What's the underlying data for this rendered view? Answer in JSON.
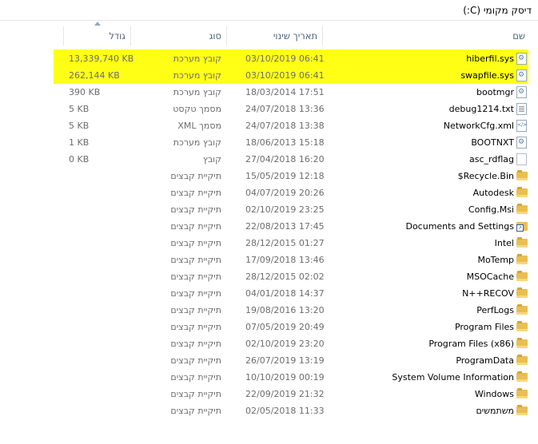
{
  "window": {
    "title": "דיסק מקומי (C:)"
  },
  "columns": {
    "name": "שם",
    "date": "תאריך שינוי",
    "type": "סוג",
    "size": "גודל"
  },
  "files": [
    {
      "name": "hiberfil.sys",
      "date": "03/10/2019 06:41",
      "type": "קובץ מערכת",
      "size": "13,339,740 KB",
      "icon": "system-file-icon",
      "highlighted": true
    },
    {
      "name": "swapfile.sys",
      "date": "03/10/2019 06:41",
      "type": "קובץ מערכת",
      "size": "262,144 KB",
      "icon": "system-file-icon",
      "highlighted": true
    },
    {
      "name": "bootmgr",
      "date": "18/03/2014 17:51",
      "type": "קובץ מערכת",
      "size": "390 KB",
      "icon": "system-file-icon",
      "highlighted": false
    },
    {
      "name": "debug1214.txt",
      "date": "24/07/2018 13:36",
      "type": "מסמך טקסט",
      "size": "5 KB",
      "icon": "text-file-icon",
      "highlighted": false
    },
    {
      "name": "NetworkCfg.xml",
      "date": "24/07/2018 13:38",
      "type": "מסמך XML",
      "size": "5 KB",
      "icon": "xml-file-icon",
      "highlighted": false
    },
    {
      "name": "BOOTNXT",
      "date": "18/06/2013 15:18",
      "type": "קובץ מערכת",
      "size": "1 KB",
      "icon": "system-file-icon",
      "highlighted": false
    },
    {
      "name": "asc_rdflag",
      "date": "27/04/2018 16:20",
      "type": "קובץ",
      "size": "0 KB",
      "icon": "blank-file-icon",
      "highlighted": false
    },
    {
      "name": "$Recycle.Bin",
      "date": "15/05/2019 12:18",
      "type": "תיקיית קבצים",
      "size": "",
      "icon": "folder-icon",
      "highlighted": false
    },
    {
      "name": "Autodesk",
      "date": "04/07/2019 20:26",
      "type": "תיקיית קבצים",
      "size": "",
      "icon": "folder-icon",
      "highlighted": false
    },
    {
      "name": "Config.Msi",
      "date": "02/10/2019 23:25",
      "type": "תיקיית קבצים",
      "size": "",
      "icon": "folder-icon",
      "highlighted": false
    },
    {
      "name": "Documents and Settings",
      "date": "22/08/2013 17:45",
      "type": "תיקיית קבצים",
      "size": "",
      "icon": "folder-shortcut-icon",
      "highlighted": false
    },
    {
      "name": "Intel",
      "date": "28/12/2015 01:27",
      "type": "תיקיית קבצים",
      "size": "",
      "icon": "folder-icon",
      "highlighted": false
    },
    {
      "name": "MoTemp",
      "date": "17/09/2018 13:46",
      "type": "תיקיית קבצים",
      "size": "",
      "icon": "folder-icon",
      "highlighted": false
    },
    {
      "name": "MSOCache",
      "date": "28/12/2015 02:02",
      "type": "תיקיית קבצים",
      "size": "",
      "icon": "folder-icon",
      "highlighted": false
    },
    {
      "name": "N++RECOV",
      "date": "04/01/2018 14:37",
      "type": "תיקיית קבצים",
      "size": "",
      "icon": "folder-icon",
      "highlighted": false
    },
    {
      "name": "PerfLogs",
      "date": "19/08/2016 13:20",
      "type": "תיקיית קבצים",
      "size": "",
      "icon": "folder-icon",
      "highlighted": false
    },
    {
      "name": "Program Files",
      "date": "07/05/2019 20:49",
      "type": "תיקיית קבצים",
      "size": "",
      "icon": "folder-icon",
      "highlighted": false
    },
    {
      "name": "Program Files (x86)",
      "date": "02/10/2019 23:20",
      "type": "תיקיית קבצים",
      "size": "",
      "icon": "folder-icon",
      "highlighted": false
    },
    {
      "name": "ProgramData",
      "date": "26/07/2019 13:19",
      "type": "תיקיית קבצים",
      "size": "",
      "icon": "folder-icon",
      "highlighted": false
    },
    {
      "name": "System Volume Information",
      "date": "10/10/2019 00:19",
      "type": "תיקיית קבצים",
      "size": "",
      "icon": "folder-icon",
      "highlighted": false
    },
    {
      "name": "Windows",
      "date": "22/09/2019 21:32",
      "type": "תיקיית קבצים",
      "size": "",
      "icon": "folder-icon",
      "highlighted": false
    },
    {
      "name": "משתמשים",
      "date": "02/05/2018 11:33",
      "type": "תיקיית קבצים",
      "size": "",
      "icon": "folder-icon",
      "highlighted": false
    }
  ],
  "colors": {
    "highlight": "#ffff16",
    "folder": "#e8bf53",
    "header_text": "#4c607a"
  }
}
